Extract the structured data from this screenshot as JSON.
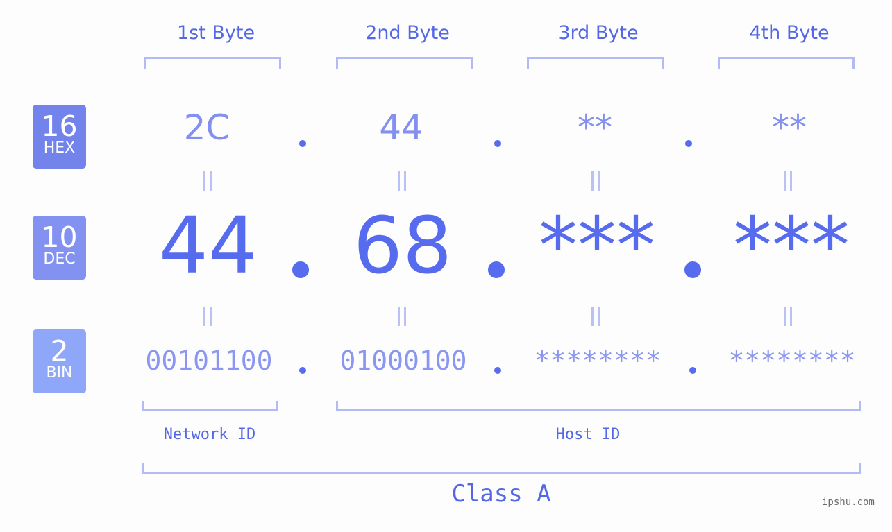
{
  "byte_headers": [
    "1st Byte",
    "2nd Byte",
    "3rd Byte",
    "4th Byte"
  ],
  "badges": [
    {
      "num": "16",
      "label": "HEX",
      "color": "#7383ec"
    },
    {
      "num": "10",
      "label": "DEC",
      "color": "#8392f1"
    },
    {
      "num": "2",
      "label": "BIN",
      "color": "#8fa7f8"
    }
  ],
  "hex": [
    "2C",
    "44",
    "**",
    "**"
  ],
  "dec": [
    "44",
    "68",
    "***",
    "***"
  ],
  "bin": [
    "00101100",
    "01000100",
    "********",
    "********"
  ],
  "network_label": "Network ID",
  "host_label": "Host ID",
  "class_label": "Class A",
  "watermark": "ipshu.com"
}
